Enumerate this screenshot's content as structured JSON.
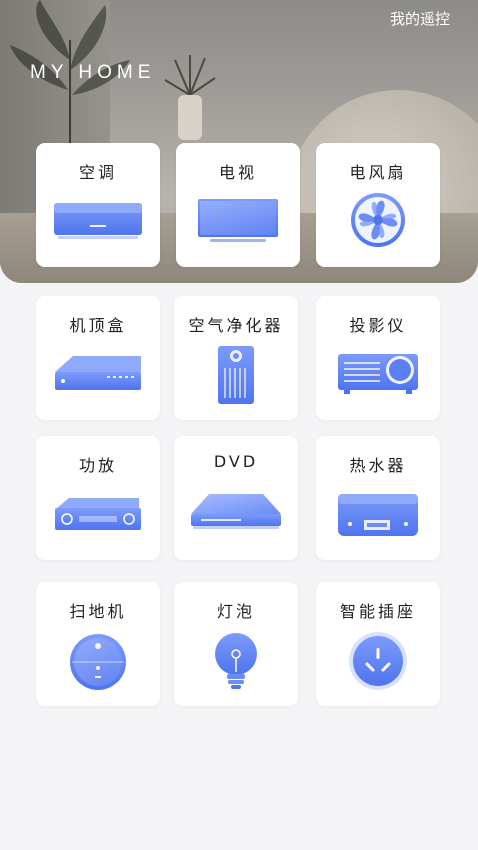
{
  "header": {
    "remote_link": "我的遥控",
    "title": "MY HOME"
  },
  "accent_color": "#5b83f5",
  "devices": [
    {
      "label": "空调",
      "icon": "air-conditioner-icon"
    },
    {
      "label": "电视",
      "icon": "tv-icon"
    },
    {
      "label": "电风扇",
      "icon": "fan-icon"
    },
    {
      "label": "机顶盒",
      "icon": "set-top-box-icon"
    },
    {
      "label": "空气净化器",
      "icon": "air-purifier-icon"
    },
    {
      "label": "投影仪",
      "icon": "projector-icon"
    },
    {
      "label": "功放",
      "icon": "amplifier-icon"
    },
    {
      "label": "DVD",
      "icon": "dvd-player-icon"
    },
    {
      "label": "热水器",
      "icon": "water-heater-icon"
    },
    {
      "label": "扫地机",
      "icon": "robot-vacuum-icon"
    },
    {
      "label": "灯泡",
      "icon": "light-bulb-icon"
    },
    {
      "label": "智能插座",
      "icon": "smart-socket-icon"
    }
  ]
}
